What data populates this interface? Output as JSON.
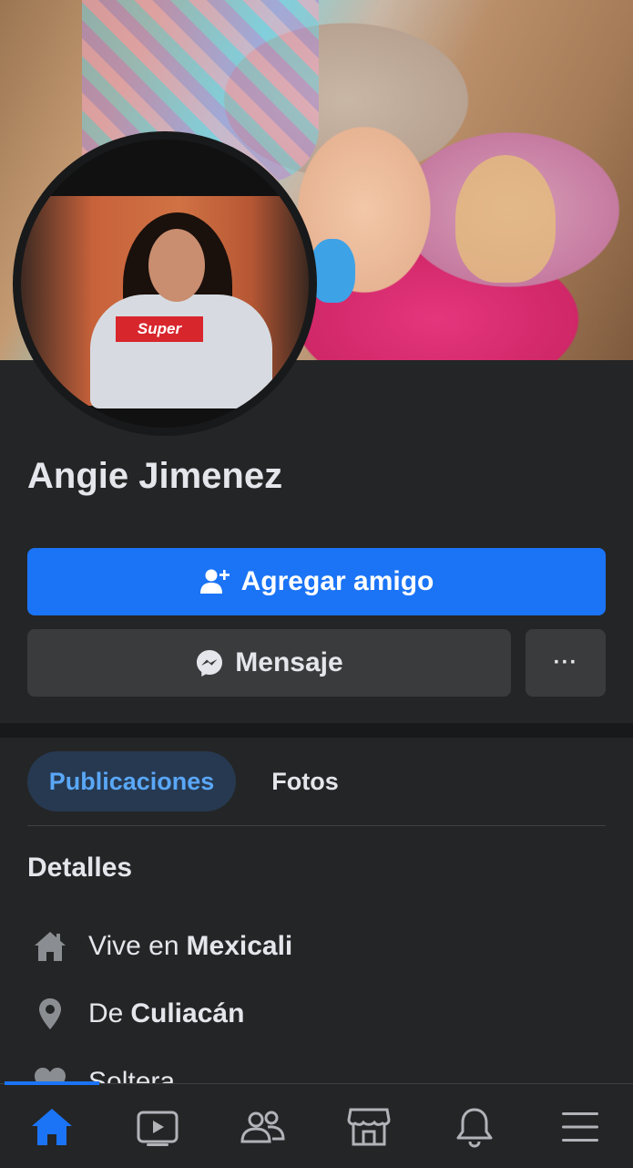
{
  "profile": {
    "name": "Angie Jimenez"
  },
  "actions": {
    "add_friend_label": "Agregar amigo",
    "message_label": "Mensaje",
    "more_label": "···"
  },
  "tabs": [
    {
      "label": "Publicaciones",
      "active": true
    },
    {
      "label": "Fotos",
      "active": false
    }
  ],
  "details": {
    "title": "Detalles",
    "items": [
      {
        "icon": "home-icon",
        "prefix": "Vive en",
        "value": "Mexicali"
      },
      {
        "icon": "location-pin-icon",
        "prefix": "De",
        "value": "Culiacán"
      },
      {
        "icon": "heart-icon",
        "prefix": "Soltera",
        "value": ""
      }
    ]
  },
  "avatar_shirt_text": "Super",
  "bottom_nav": [
    {
      "icon": "home-icon",
      "active": true
    },
    {
      "icon": "video-icon",
      "active": false
    },
    {
      "icon": "friends-icon",
      "active": false
    },
    {
      "icon": "marketplace-icon",
      "active": false
    },
    {
      "icon": "bell-icon",
      "active": false
    },
    {
      "icon": "menu-icon",
      "active": false
    }
  ],
  "colors": {
    "accent": "#1b74f6",
    "background": "#242526",
    "button": "#3a3b3c",
    "active_tab_bg": "#263951",
    "active_tab_text": "#5aa7f7"
  }
}
